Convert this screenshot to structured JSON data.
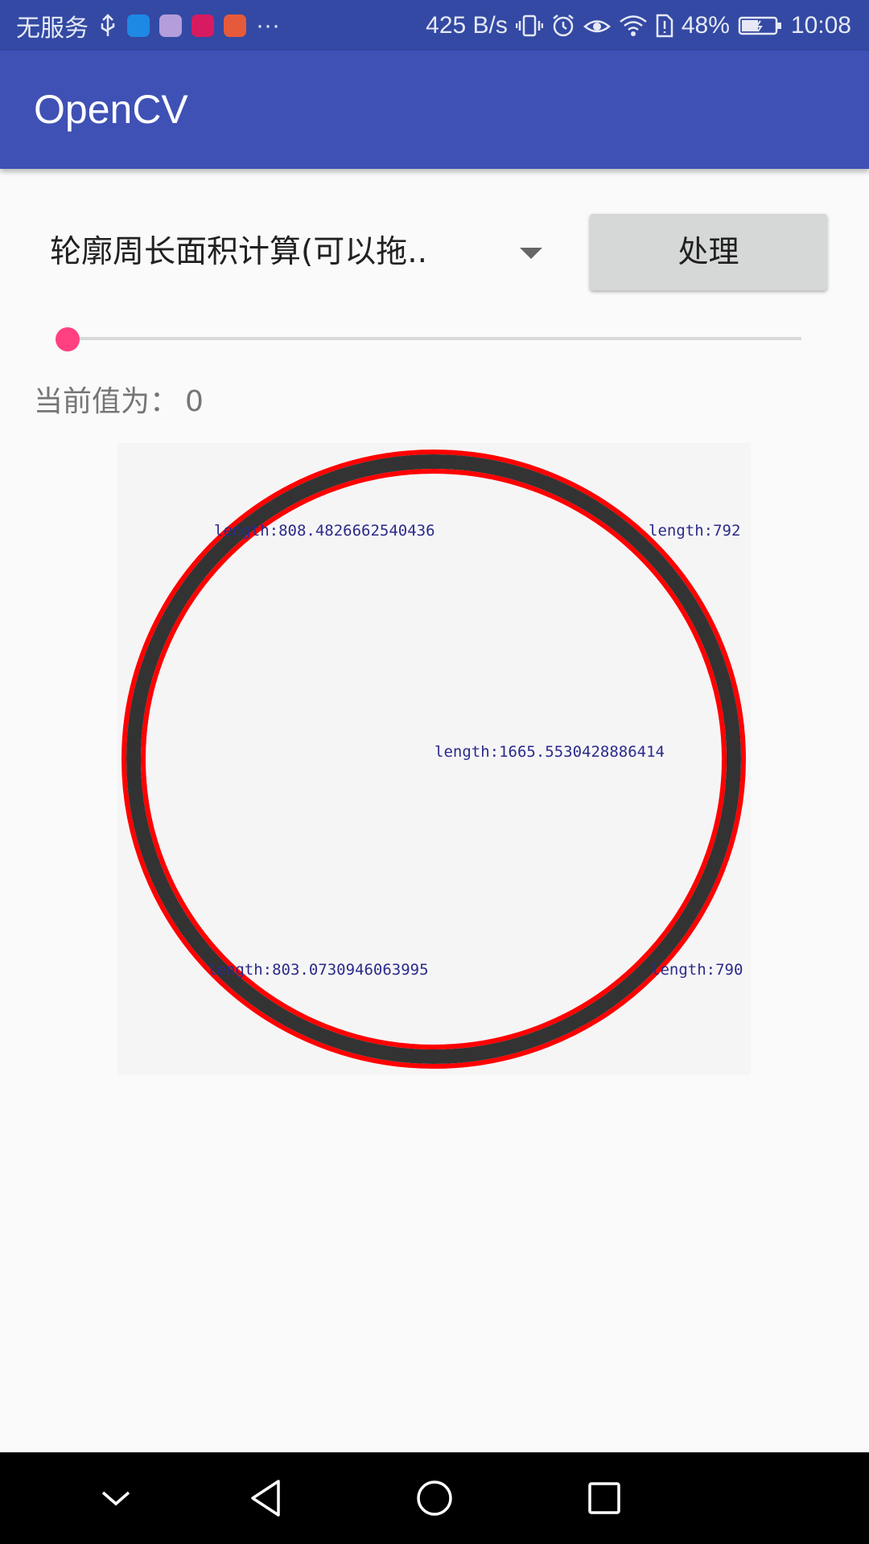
{
  "status_bar": {
    "carrier": "无服务",
    "overflow": "···",
    "net_speed": "425 B/s",
    "battery": "48%",
    "time": "10:08",
    "icons": [
      "usb-icon",
      "browser-app-icon",
      "gallery-app-icon",
      "huawei-app-icon",
      "video-app-icon",
      "vibrate-icon",
      "alarm-icon",
      "eye-comfort-icon",
      "wifi-icon",
      "sim-icon",
      "battery-icon"
    ],
    "app_badge_colors": [
      "#1e88e5",
      "#b39ddb",
      "#d81b60",
      "#e65a3c"
    ]
  },
  "app_bar": {
    "title": "OpenCV",
    "color": "#3f51b5",
    "status_color": "#3349a3"
  },
  "controls": {
    "spinner_value": "轮廓周长面积计算(可以拖..",
    "process_button": "处理",
    "slider_value": 0,
    "slider_color": "#ff4081",
    "current_value_label": "当前值为：",
    "current_value": "0"
  },
  "result_image": {
    "labels": [
      "length:808.4826662540436",
      "length:792",
      "length:1665.5530428886414",
      "length:803.0730946063995",
      "length:790"
    ],
    "contour_color": "#ff0000",
    "ring_color": "#333333",
    "text_color": "#2b2b8a"
  },
  "nav_bar": {
    "buttons": [
      "collapse",
      "back",
      "home",
      "recents"
    ]
  }
}
